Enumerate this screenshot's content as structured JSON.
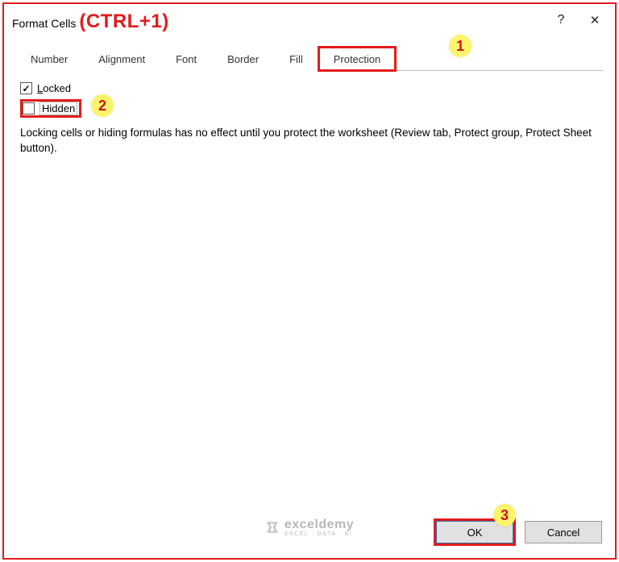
{
  "titlebar": {
    "title": "Format Cells",
    "shortcut_annotation": "(CTRL+1)",
    "help_tooltip": "?",
    "close_tooltip": "✕"
  },
  "tabs": {
    "items": [
      {
        "label": "Number"
      },
      {
        "label": "Alignment"
      },
      {
        "label": "Font"
      },
      {
        "label": "Border"
      },
      {
        "label": "Fill"
      },
      {
        "label": "Protection"
      }
    ],
    "active_index": 5
  },
  "protection_panel": {
    "locked_prefix": "L",
    "locked_rest": "ocked",
    "locked_checked": true,
    "hidden_prefix": "H",
    "hidden_label": "idden",
    "hidden_checked": false,
    "explain_text": "Locking cells or hiding formulas has no effect until you protect the worksheet (Review tab, Protect group, Protect Sheet button)."
  },
  "footer": {
    "ok_label": "OK",
    "cancel_label": "Cancel"
  },
  "watermark": {
    "name": "exceldemy",
    "sub": "EXCEL · DATA · BI"
  },
  "callouts": {
    "one": "1",
    "two": "2",
    "three": "3"
  }
}
